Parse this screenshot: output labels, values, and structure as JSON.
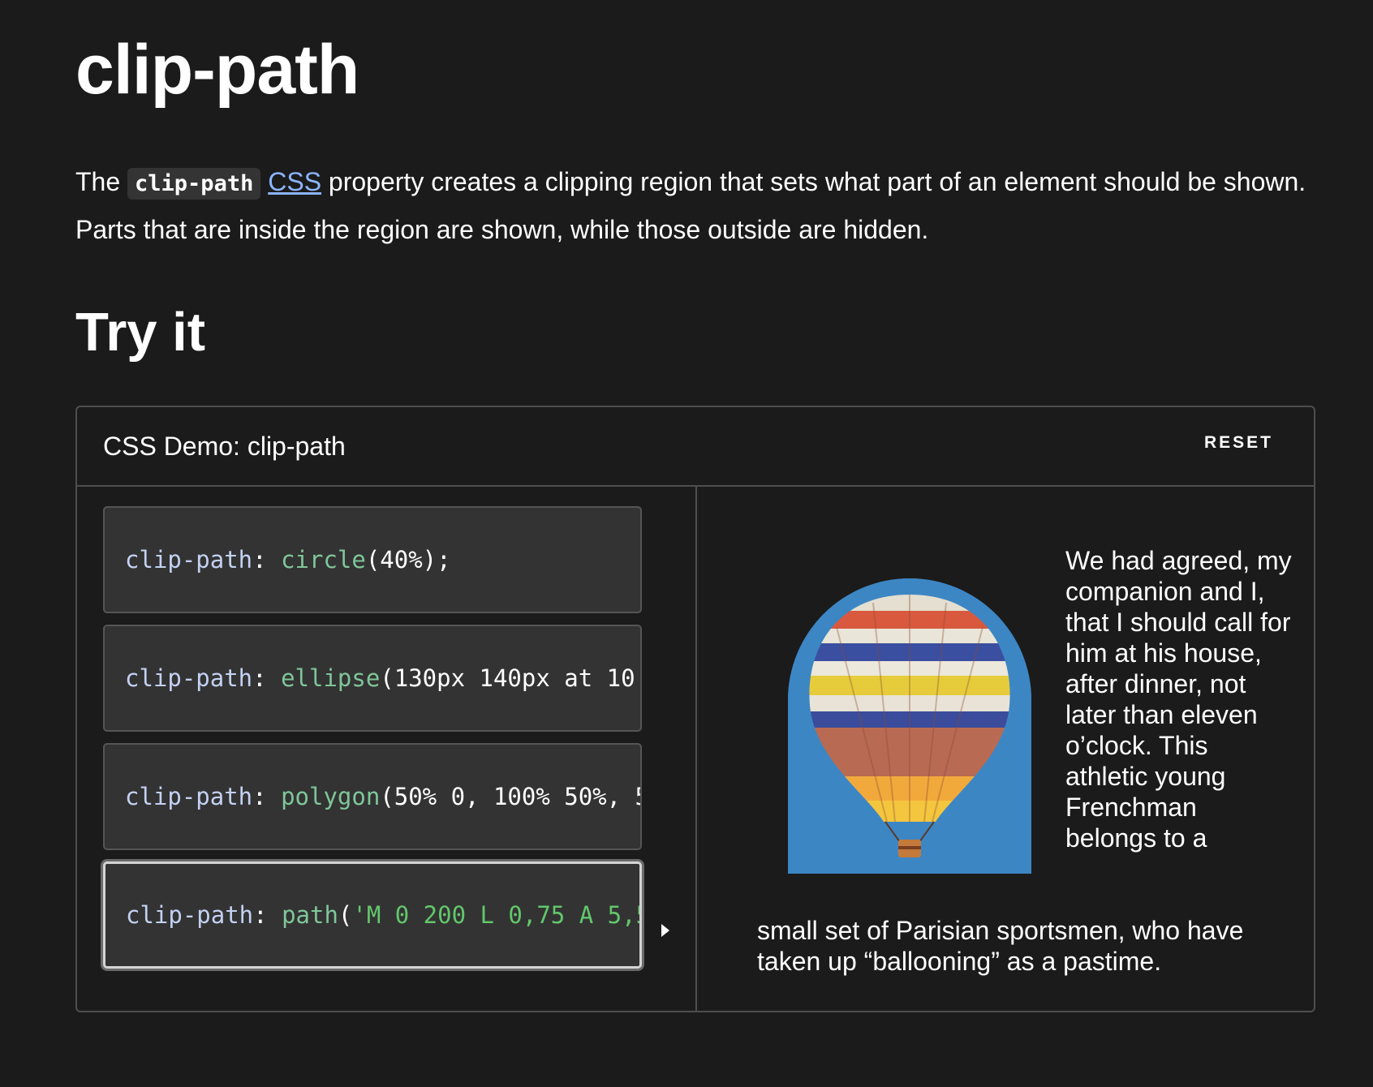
{
  "header": {
    "title": "clip-path",
    "intro_before_code": "The ",
    "intro_code": "clip-path",
    "intro_link": "CSS",
    "intro_after": " property creates a clipping region that sets what part of an element should be shown. Parts that are inside the region are shown, while those outside are hidden."
  },
  "try_it": {
    "title": "Try it"
  },
  "demo": {
    "title": "CSS Demo: clip-path",
    "reset_label": "RESET",
    "choices": [
      {
        "prop": "clip-path",
        "colon": ": ",
        "fn": "circle",
        "args": "(40%);",
        "selected": false
      },
      {
        "prop": "clip-path",
        "colon": ": ",
        "fn": "ellipse",
        "args": "(130px 140px at 10",
        "selected": false
      },
      {
        "prop": "clip-path",
        "colon": ": ",
        "fn": "polygon",
        "args": "(50% 0, 100% 50%, 5",
        "selected": false
      },
      {
        "prop": "clip-path",
        "colon": ": ",
        "fn": "path",
        "open": "(",
        "str": "'M 0 200 L 0,75 A 5,5",
        "selected": true
      }
    ],
    "output": {
      "image_alt": "hot-air-balloon",
      "text_side": "We had agreed, my companion and I, that I should call for him at his house, after dinner, not later than eleven o’clock. This athletic young Frenchman belongs to a",
      "text_bottom": "small set of Parisian sportsmen, who have taken up “ballooning” as a pastime."
    }
  },
  "colors": {
    "background": "#1b1b1b",
    "panel": "#333333",
    "border": "#4e4e4e",
    "link": "#8cb4ff",
    "property_token": "#c3d1f2",
    "function_token": "#7fc69a",
    "string_token": "#62c76b",
    "sky": "#3d86c4"
  }
}
